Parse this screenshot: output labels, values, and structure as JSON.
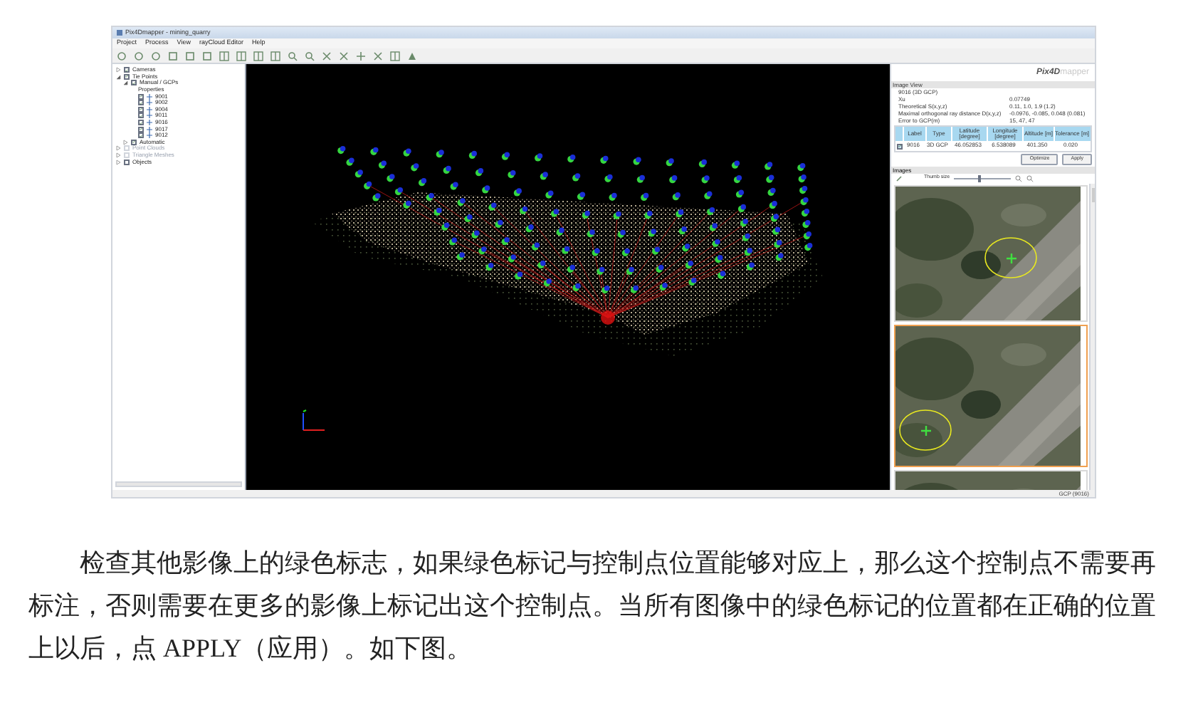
{
  "window": {
    "title": "Pix4Dmapper - mining_quarry"
  },
  "menu": [
    "Project",
    "Process",
    "View",
    "rayCloud Editor",
    "Help"
  ],
  "tree": [
    {
      "label": "Cameras",
      "checked": true,
      "disabled": false,
      "expanded": false
    },
    {
      "label": "Tie Points",
      "checked": true,
      "disabled": false,
      "expanded": true,
      "children": [
        {
          "label": "Manual / GCPs",
          "checked": true,
          "disabled": false,
          "expanded": true,
          "children": [
            {
              "label": "Properties",
              "kind": "plain"
            },
            {
              "label": "9001",
              "checked": true,
              "disabled": false,
              "kind": "gcp"
            },
            {
              "label": "9002",
              "checked": true,
              "disabled": false,
              "kind": "gcp"
            },
            {
              "label": "9004",
              "checked": true,
              "disabled": false,
              "kind": "gcp"
            },
            {
              "label": "9011",
              "checked": true,
              "disabled": false,
              "kind": "gcp"
            },
            {
              "label": "9016",
              "checked": true,
              "disabled": false,
              "kind": "gcp"
            },
            {
              "label": "9017",
              "checked": true,
              "disabled": false,
              "kind": "gcp"
            },
            {
              "label": "9012",
              "checked": true,
              "disabled": false,
              "kind": "gcp"
            }
          ]
        },
        {
          "label": "Automatic",
          "checked": true,
          "disabled": false,
          "expanded": false
        }
      ]
    },
    {
      "label": "Point Clouds",
      "checked": false,
      "disabled": true,
      "expanded": false
    },
    {
      "label": "Triangle Meshes",
      "checked": false,
      "disabled": true,
      "expanded": false
    },
    {
      "label": "Objects",
      "checked": false,
      "disabled": false,
      "expanded": false
    }
  ],
  "logo": {
    "main": "Pix4D",
    "sub": "mapper"
  },
  "panel": {
    "title": "Image View",
    "heading": "9016 (3D GCP)",
    "info": [
      {
        "label": "Xu",
        "value": "0.07749"
      },
      {
        "label": "Theoretical S(x,y,z)",
        "value": "0.11, 1.0, 1.9 (1.2)"
      },
      {
        "label": "Maximal orthogonal ray distance D(x,y,z)",
        "value": "-0.0976, -0.085, 0.048 (0.081)"
      },
      {
        "label": "Error to GCP(m)",
        "value": "15, 47, 47"
      }
    ],
    "table": {
      "columns": [
        "Label",
        "Type",
        "Latitude [degree]",
        "Longitude [degree]",
        "Altitude [m]",
        "Tolerance [m]"
      ],
      "rows": [
        {
          "checked": true,
          "cells": [
            "9016",
            "3D GCP",
            "46.052853",
            "6.538089",
            "401.350",
            "0.020"
          ]
        }
      ]
    },
    "buttons": [
      "Optimize",
      "Apply"
    ]
  },
  "images": {
    "title": "Images",
    "thumb_label": "Thumb size",
    "thumb_size": {
      "level": 0.45
    },
    "thumbnails": [
      {
        "selected": false,
        "marked": true
      },
      {
        "selected": true,
        "marked": true
      },
      {
        "selected": false,
        "marked": false
      }
    ]
  },
  "status_bar": "GCP (9016)",
  "paragraph": "检查其他影像上的绿色标志，如果绿色标记与控制点位置能够对应上，那么这个控制点不需要再标注，否则需要在更多的影像上标记出这个控制点。当所有图像中的绿色标记的位置都在正确的位置上以后，点 APPLY（应用）。如下图。"
}
